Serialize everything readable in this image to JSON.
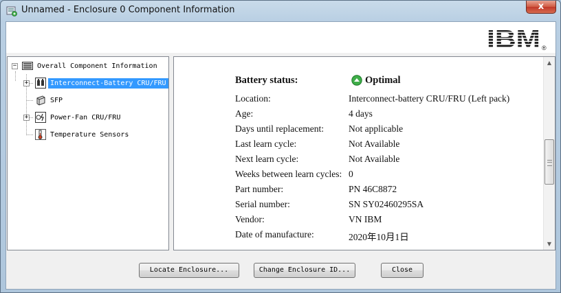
{
  "window": {
    "title": "Unnamed - Enclosure 0 Component Information",
    "close_glyph": "x"
  },
  "brand": {
    "logo_text": "IBM",
    "logo_mark": "®"
  },
  "tree": {
    "root": {
      "label": "Overall Component Information",
      "icon": "enclosure-icon"
    },
    "items": [
      {
        "label": "Interconnect-Battery CRU/FRU",
        "icon": "battery-icon",
        "expander": "+",
        "selected": true
      },
      {
        "label": "SFP",
        "icon": "sfp-icon",
        "expander": "",
        "selected": false
      },
      {
        "label": "Power-Fan CRU/FRU",
        "icon": "power-fan-icon",
        "expander": "+",
        "selected": false
      },
      {
        "label": "Temperature Sensors",
        "icon": "thermometer-icon",
        "expander": "",
        "selected": false
      }
    ]
  },
  "details": {
    "status": {
      "key": "Battery status:",
      "value": "Optimal",
      "icon": "optimal-status-icon",
      "color": "#3fae49"
    },
    "rows": [
      {
        "key": "Location:",
        "value": "Interconnect-battery CRU/FRU (Left pack)"
      },
      {
        "key": "Age:",
        "value": "4 days"
      },
      {
        "key": "Days until replacement:",
        "value": "Not applicable"
      },
      {
        "key": "Last learn cycle:",
        "value": "Not Available"
      },
      {
        "key": "Next learn cycle:",
        "value": "Not Available"
      },
      {
        "key": "Weeks between learn cycles:",
        "value": "0"
      },
      {
        "key": "Part number:",
        "value": "PN 46C8872"
      },
      {
        "key": "Serial number:",
        "value": "SN SY02460295SA"
      },
      {
        "key": "Vendor:",
        "value": "VN IBM"
      },
      {
        "key": "Date of manufacture:",
        "value": "2020年10月1日"
      }
    ]
  },
  "buttons": {
    "locate": "Locate Enclosure...",
    "change_id": "Change Enclosure ID...",
    "close": "Close"
  },
  "colors": {
    "selection": "#3399ff",
    "ibm_logo": "#1a1a1a"
  }
}
